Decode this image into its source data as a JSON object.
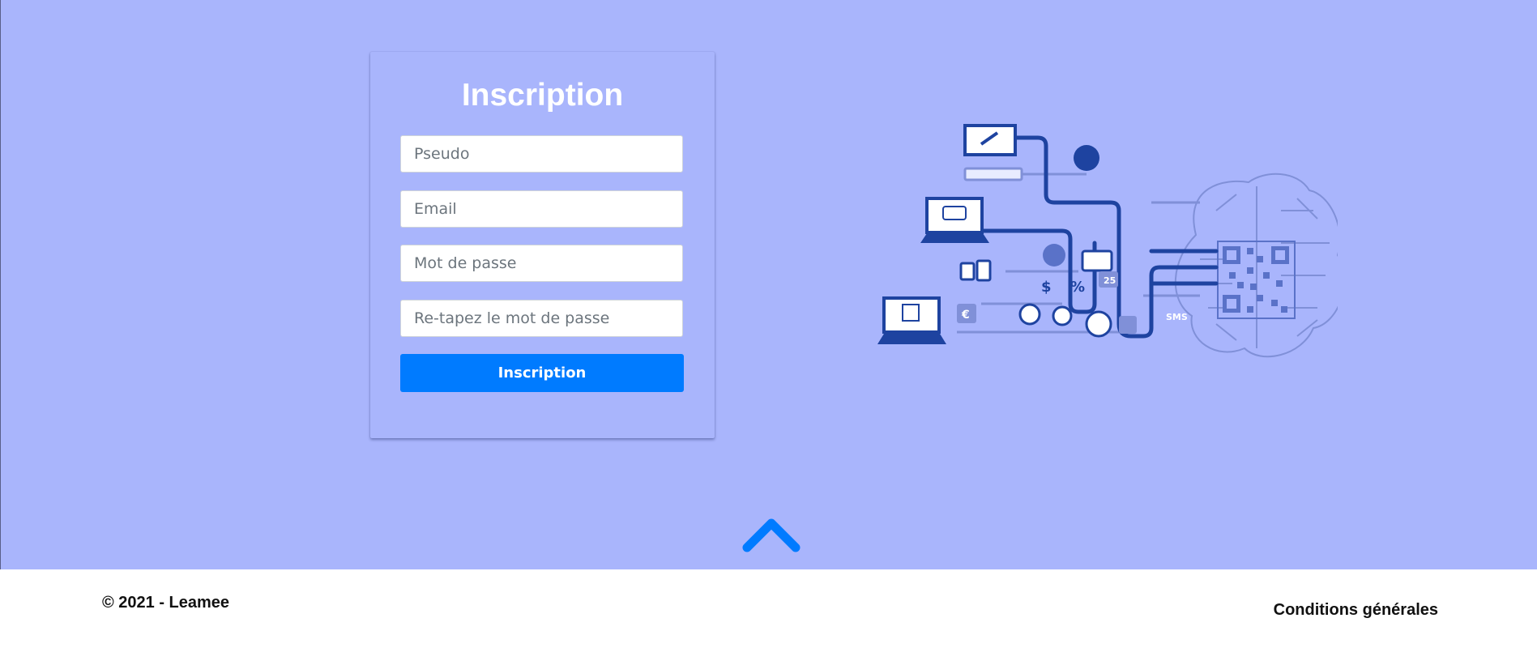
{
  "form": {
    "title": "Inscription",
    "fields": [
      {
        "placeholder": "Pseudo",
        "value": ""
      },
      {
        "placeholder": "Email",
        "value": ""
      },
      {
        "placeholder": "Mot de passe",
        "value": ""
      },
      {
        "placeholder": "Re-tapez le mot de passe",
        "value": ""
      }
    ],
    "submit_label": "Inscription"
  },
  "illustration": {
    "icon": "digital-brain-network-icon",
    "texts": {
      "percent": "%",
      "dollar": "$",
      "euro": "€",
      "date": "25",
      "sms": "SMS"
    }
  },
  "scroll_top": {
    "icon": "chevron-up-icon"
  },
  "footer": {
    "copyright": "© 2021 - Leamee",
    "terms_label": "Conditions générales"
  },
  "colors": {
    "background": "#a9b5fc",
    "primary_button": "#007bff",
    "footer_background": "#ffffff",
    "illustration_dark": "#1e43a0",
    "illustration_light": "#8090d8"
  }
}
